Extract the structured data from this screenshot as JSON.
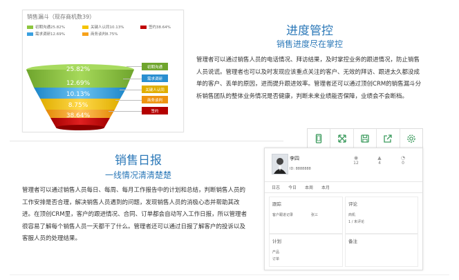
{
  "funnel": {
    "title": "销售漏斗（现存商机数39）",
    "legend": [
      {
        "label": "初期沟通25.82%",
        "color": "#8dc63f"
      },
      {
        "label": "关键人认同10.13%",
        "color": "#f5c400"
      },
      {
        "label": "签约38.64%",
        "color": "#c00000"
      },
      {
        "label": "需求调研12.69%",
        "color": "#3aa0e0"
      },
      {
        "label": "商务谈判8.75%",
        "color": "#f7a21b"
      }
    ],
    "stages": [
      {
        "value": "25.82%",
        "tag": "初期沟通",
        "color": "#8dc63f"
      },
      {
        "value": "12.69%",
        "tag": "需求调研",
        "color": "#3aa0e0"
      },
      {
        "value": "10.13%",
        "tag": "关键人认同",
        "color": "#f5c400"
      },
      {
        "value": "8.75%",
        "tag": "商务谈判",
        "color": "#f7a21b"
      },
      {
        "value": "38.64%",
        "tag": "签约",
        "color": "#c00000"
      }
    ]
  },
  "progress": {
    "title": "进度管控",
    "subtitle": "销售进度尽在掌控",
    "body": "管理者可以通过销售人员的电话情况、拜访结果，及时掌控业务的跟进情况，防止销售人员说谎。管理者也可以及时发现应该重点关注的客户、无效的拜访、跟进太久都没成单的客户、丢单的原因，进而提升跟进效率。管理者还可以通过顶创CRM的销售漏斗分析销售团队的整体业务情况是否健康，判断未来业绩能否保障，业绩会不会断档。"
  },
  "daily": {
    "title": "销售日报",
    "subtitle": "一线情况清清楚楚",
    "body": "管理者可以通过销售人员每日、每周、每月工作报告中的计划和总结，判断销售人员的工作安排是否合理，解决销售人员遇到的问题，发现销售人员的消极心态并帮助其改进。在顶创CRM里，客户的跟进情况、合同、订单都会自动写入工作日报，所以管理者很容易了解每个销售人员一天都干了什么。管理者还可以通过日报了解客户的投诉以及客服人员的处理结果。"
  },
  "toolbar": {
    "icons": [
      "phone-icon",
      "expand-icon",
      "save-icon",
      "share-icon",
      "settings-icon"
    ]
  },
  "report": {
    "name": "李四",
    "code": "ID: 8888888",
    "stats": [
      "12",
      "4",
      "0"
    ],
    "tabs": [
      "日志",
      "今日",
      "本周",
      "本月"
    ],
    "section1": "跟踪",
    "section2": "评论",
    "section3": "计划",
    "section4": "备注",
    "rowlabel1": "客户跟进记录",
    "rowlabel2": "商机",
    "rowval1": "张三",
    "rowval2": "1 / 未评论",
    "rowlabel3": "产品",
    "rowlabel4": "订单"
  },
  "colors": {
    "accent": "#2b78b8",
    "green_icon": "#3a9a5c"
  }
}
